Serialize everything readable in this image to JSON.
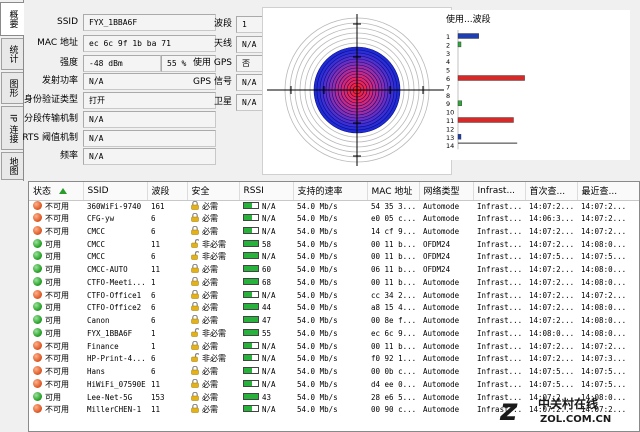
{
  "tabs": [
    "概要",
    "统计",
    "图形",
    "IP 连接",
    "地图"
  ],
  "info": {
    "ssid_label": "SSID",
    "ssid": "FYX_1BBA6F",
    "mac_label": "MAC 地址",
    "mac": "ec 6c 9f 1b ba 71",
    "strength_label": "强度",
    "strength_dbm": "-48 dBm",
    "strength_pct": "55 %",
    "tx_label": "发射功率",
    "tx": "N/A",
    "auth_label": "身份验证类型",
    "auth": "打开",
    "frag_label": "分段传输机制",
    "frag": "N/A",
    "rts_label": "RTS 阈值机制",
    "rts": "N/A",
    "freq_label": "频率",
    "freq": "N/A",
    "band_label": "波段",
    "band": "1",
    "antenna_label": "天线",
    "antenna": "N/A",
    "gps_label": "使用 GPS",
    "gps": "否",
    "gpssig_label": "GPS 信号",
    "gpssig": "N/A",
    "sat_label": "卫星",
    "sat": "N/A"
  },
  "mini_chart": {
    "title": "使用...波段",
    "channels": [
      "1",
      "2",
      "3",
      "4",
      "5",
      "6",
      "7",
      "8",
      "9",
      "10",
      "11",
      "12",
      "13",
      "14"
    ],
    "bars": [
      {
        "channel": 1,
        "value": 0.28,
        "color": "#1f3fae"
      },
      {
        "channel": 2,
        "value": 0.04,
        "color": "#2ea83a"
      },
      {
        "channel": 6,
        "value": 0.9,
        "color": "#d42a2a"
      },
      {
        "channel": 9,
        "value": 0.05,
        "color": "#2ea83a"
      },
      {
        "channel": 11,
        "value": 0.75,
        "color": "#d42a2a"
      },
      {
        "channel": 13,
        "value": 0.04,
        "color": "#1f3fae"
      },
      {
        "channel": 14,
        "value": 0.8,
        "color": "#000000"
      }
    ]
  },
  "table": {
    "headers": [
      "状态",
      "SSID",
      "波段",
      "安全",
      "RSSI",
      "支持的速率",
      "MAC 地址",
      "网络类型",
      "Infrast...",
      "首次查...",
      "最近查..."
    ],
    "rows": [
      [
        "red",
        "不可用",
        "360WiFi-9740",
        "161",
        "lock-gold",
        "必需",
        4,
        "N/A",
        "54.0 Mb/s",
        "54 35 3...",
        "Automode",
        "Infrast...",
        "14:07:2...",
        "14:07:2..."
      ],
      [
        "red",
        "不可用",
        "CFG-yw",
        "6",
        "lock-gold",
        "必需",
        4,
        "N/A",
        "54.0 Mb/s",
        "e0 05 c...",
        "Automode",
        "Infrast...",
        "14:06:3...",
        "14:07:2..."
      ],
      [
        "red",
        "不可用",
        "CMCC",
        "6",
        "lock-gold",
        "必需",
        4,
        "N/A",
        "54.0 Mb/s",
        "14 cf 9...",
        "Automode",
        "Infrast...",
        "14:07:2...",
        "14:07:2..."
      ],
      [
        "green",
        "可用",
        "CMCC",
        "11",
        "lock-open",
        "非必需",
        7,
        "58",
        "54.0 Mb/s",
        "00 11 b...",
        "OFDM24",
        "Infrast...",
        "14:07:2...",
        "14:08:0..."
      ],
      [
        "green",
        "可用",
        "CMCC",
        "6",
        "lock-open",
        "非必需",
        7,
        "N/A",
        "54.0 Mb/s",
        "00 11 b...",
        "OFDM24",
        "Infrast...",
        "14:07:5...",
        "14:07:5..."
      ],
      [
        "green",
        "可用",
        "CMCC-AUTO",
        "11",
        "lock-gold",
        "必需",
        7,
        "60",
        "54.0 Mb/s",
        "06 11 b...",
        "OFDM24",
        "Infrast...",
        "14:07:2...",
        "14:08:0..."
      ],
      [
        "green",
        "可用",
        "CTFO-Meeti...",
        "1",
        "lock-gold",
        "必需",
        7,
        "68",
        "54.0 Mb/s",
        "00 11 b...",
        "Automode",
        "Infrast...",
        "14:07:2...",
        "14:08:0..."
      ],
      [
        "red",
        "不可用",
        "CTFO-Office1",
        "6",
        "lock-gold",
        "必需",
        4,
        "N/A",
        "54.0 Mb/s",
        "cc 34 2...",
        "Automode",
        "Infrast...",
        "14:07:2...",
        "14:07:2..."
      ],
      [
        "green",
        "可用",
        "CTFO-Office2",
        "6",
        "lock-gold",
        "必需",
        7,
        "44",
        "54.0 Mb/s",
        "a8 15 4...",
        "Automode",
        "Infrast...",
        "14:07:2...",
        "14:08:0..."
      ],
      [
        "green",
        "可用",
        "Canon",
        "6",
        "lock-gold",
        "必需",
        7,
        "47",
        "54.0 Mb/s",
        "00 8e f...",
        "Automode",
        "Infrast...",
        "14:07:2...",
        "14:08:0..."
      ],
      [
        "green",
        "可用",
        "FYX_1BBA6F",
        "1",
        "lock-open",
        "非必需",
        7,
        "55",
        "54.0 Mb/s",
        "ec 6c 9...",
        "Automode",
        "Infrast...",
        "14:08:0...",
        "14:08:0..."
      ],
      [
        "red",
        "不可用",
        "Finance",
        "1",
        "lock-gold",
        "必需",
        4,
        "N/A",
        "54.0 Mb/s",
        "00 11 b...",
        "Automode",
        "Infrast...",
        "14:07:2...",
        "14:07:2..."
      ],
      [
        "red",
        "不可用",
        "HP-Print-4...",
        "6",
        "lock-open",
        "非必需",
        4,
        "N/A",
        "54.0 Mb/s",
        "f0 92 1...",
        "Automode",
        "Infrast...",
        "14:07:2...",
        "14:07:3..."
      ],
      [
        "red",
        "不可用",
        "Hans",
        "6",
        "lock-gold",
        "必需",
        4,
        "N/A",
        "54.0 Mb/s",
        "00 0b c...",
        "Automode",
        "Infrast...",
        "14:07:5...",
        "14:07:5..."
      ],
      [
        "red",
        "不可用",
        "HiWiFi_07590E",
        "11",
        "lock-gold",
        "必需",
        4,
        "N/A",
        "54.0 Mb/s",
        "d4 ee 0...",
        "Automode",
        "Infrast...",
        "14:07:5...",
        "14:07:5..."
      ],
      [
        "green",
        "可用",
        "Lee-Net-5G",
        "153",
        "lock-gold",
        "必需",
        7,
        "43",
        "54.0 Mb/s",
        "28 e6 5...",
        "Automode",
        "Infrast...",
        "14:07:2...",
        "14:08:0..."
      ],
      [
        "red",
        "不可用",
        "MillerCHEN-1",
        "11",
        "lock-gold",
        "必需",
        4,
        "N/A",
        "54.0 Mb/s",
        "00 90 c...",
        "Automode",
        "Infrast...",
        "14:07:2...",
        "14:07:2..."
      ]
    ]
  },
  "watermark": {
    "brand": "中关村在线",
    "url": "ZOL.COM.CN"
  }
}
